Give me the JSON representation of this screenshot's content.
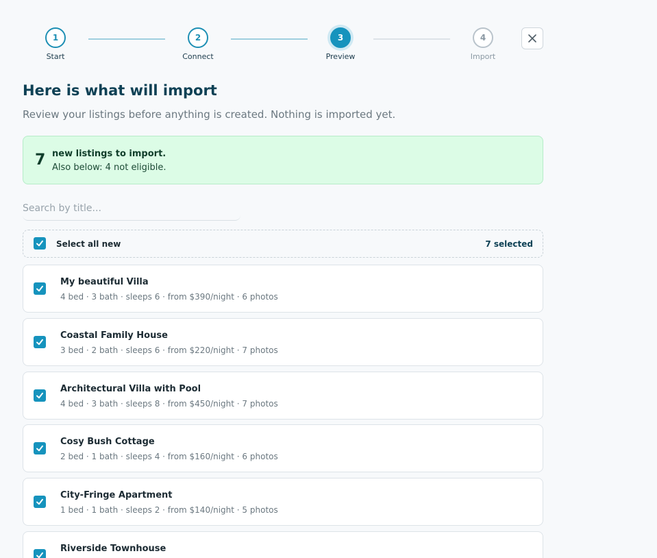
{
  "stepper": {
    "steps": [
      {
        "number": "1",
        "label": "Start",
        "state": "done"
      },
      {
        "number": "2",
        "label": "Connect",
        "state": "done"
      },
      {
        "number": "3",
        "label": "Preview",
        "state": "active"
      },
      {
        "number": "4",
        "label": "Import",
        "state": "future"
      }
    ]
  },
  "header": {
    "title": "Here is what will import",
    "subtitle": "Review your listings before anything is created. Nothing is imported yet."
  },
  "summary": {
    "count": "7",
    "headline": "new listings to import.",
    "sub": "Also below: 4 not eligible."
  },
  "search": {
    "placeholder": "Search by title...",
    "value": ""
  },
  "select_all": {
    "label": "Select all new",
    "checked": true,
    "selected_count": "7 selected"
  },
  "listings": [
    {
      "title": "My beautiful Villa",
      "meta": "4 bed · 3 bath · sleeps 6 · from $390/night · 6 photos",
      "checked": true
    },
    {
      "title": "Coastal Family House",
      "meta": "3 bed · 2 bath · sleeps 6 · from $220/night · 7 photos",
      "checked": true
    },
    {
      "title": "Architectural Villa with Pool",
      "meta": "4 bed · 3 bath · sleeps 8 · from $450/night · 7 photos",
      "checked": true
    },
    {
      "title": "Cosy Bush Cottage",
      "meta": "2 bed · 1 bath · sleeps 4 · from $160/night · 6 photos",
      "checked": true
    },
    {
      "title": "City-Fringe Apartment",
      "meta": "1 bed · 1 bath · sleeps 2 · from $140/night · 5 photos",
      "checked": true
    },
    {
      "title": "Riverside Townhouse",
      "meta": "",
      "checked": true
    }
  ],
  "icons": {
    "close": "close-icon",
    "check": "checkmark-icon"
  },
  "colors": {
    "accent": "#1693bd",
    "title": "#0e4155",
    "success_bg": "#dcfce6",
    "success_border": "#b6ecc8"
  }
}
